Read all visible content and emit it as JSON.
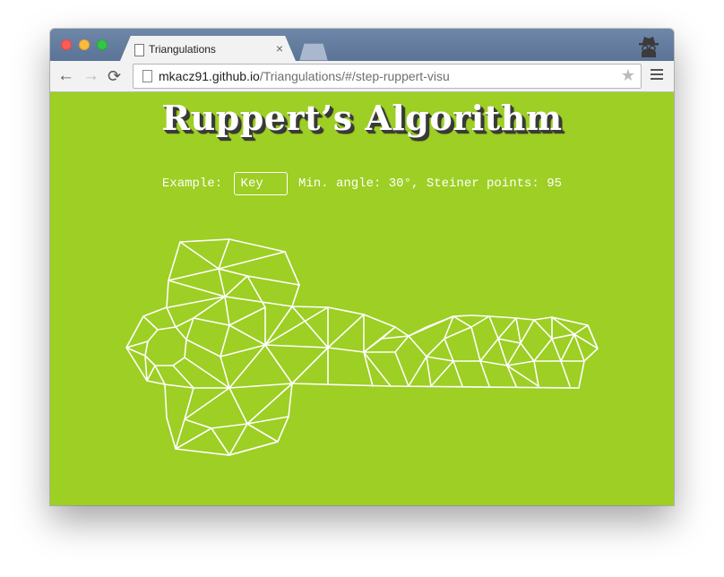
{
  "browser": {
    "tab_title": "Triangulations",
    "tab_close": "×",
    "url_host": "mkacz91.github.io",
    "url_path": "/Triangulations/#/step-ruppert-visu",
    "back": "←",
    "forward": "→",
    "reload": "⟳",
    "star": "★"
  },
  "page": {
    "title": "Ruppert’s Algorithm",
    "example_label": "Example:",
    "example_value": "Key",
    "min_angle_label": "Min. angle:",
    "min_angle_value": "30°",
    "steiner_label": "Steiner points:",
    "steiner_value": "95"
  },
  "colors": {
    "background": "#9dcf24",
    "mesh": "#ffffff"
  }
}
